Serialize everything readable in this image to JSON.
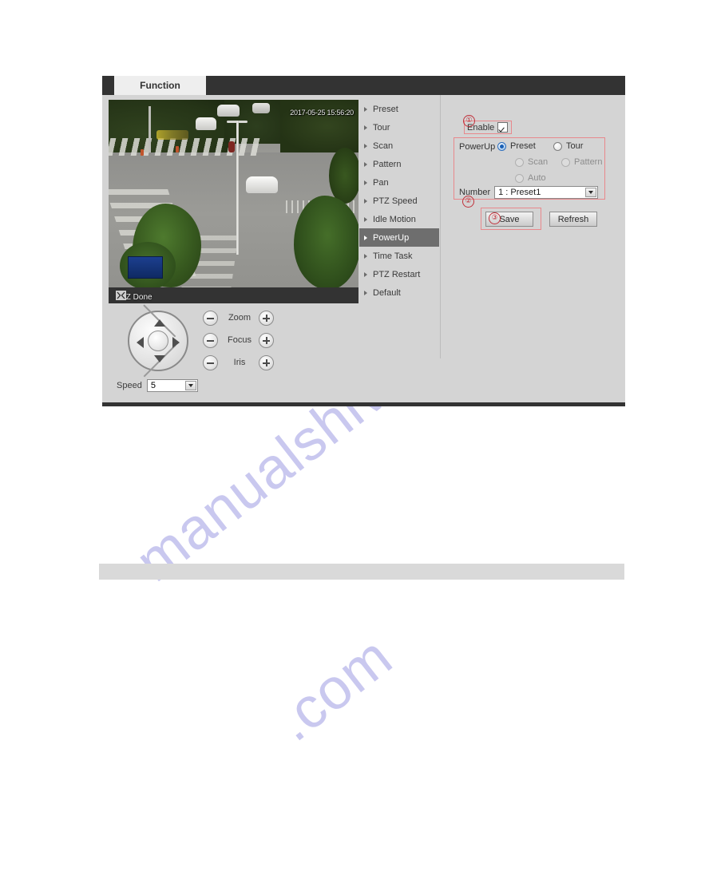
{
  "window": {
    "tab_label": "Function"
  },
  "video": {
    "timestamp": "2017-05-25 15:56:20",
    "status_text": "PTZ Done",
    "toolbar_icon": "fullscreen-icon"
  },
  "ptz_menu": {
    "items": [
      {
        "label": "Preset",
        "active": false
      },
      {
        "label": "Tour",
        "active": false
      },
      {
        "label": "Scan",
        "active": false
      },
      {
        "label": "Pattern",
        "active": false
      },
      {
        "label": "Pan",
        "active": false
      },
      {
        "label": "PTZ Speed",
        "active": false
      },
      {
        "label": "Idle Motion",
        "active": false
      },
      {
        "label": "PowerUp",
        "active": true
      },
      {
        "label": "Time Task",
        "active": false
      },
      {
        "label": "PTZ Restart",
        "active": false
      },
      {
        "label": "Default",
        "active": false
      }
    ]
  },
  "settings": {
    "enable": {
      "label": "Enable",
      "checked": true
    },
    "powerup": {
      "label": "PowerUp",
      "options": [
        {
          "label": "Preset",
          "selected": true,
          "disabled": false
        },
        {
          "label": "Tour",
          "selected": false,
          "disabled": false
        },
        {
          "label": "Scan",
          "selected": false,
          "disabled": true
        },
        {
          "label": "Pattern",
          "selected": false,
          "disabled": true
        },
        {
          "label": "Auto",
          "selected": false,
          "disabled": true
        }
      ]
    },
    "number": {
      "label": "Number",
      "value": "1 : Preset1"
    },
    "buttons": {
      "save": "Save",
      "refresh": "Refresh"
    }
  },
  "annotations": {
    "one": "①",
    "two": "②",
    "three": "③"
  },
  "ptz_controls": {
    "pad": {
      "up": "arrow-up-icon",
      "down": "arrow-down-icon",
      "left": "arrow-left-icon",
      "right": "arrow-right-icon",
      "center": "center-button"
    },
    "adjust_rows": [
      {
        "label": "Zoom"
      },
      {
        "label": "Focus"
      },
      {
        "label": "Iris"
      }
    ],
    "speed": {
      "label": "Speed",
      "value": "5"
    }
  },
  "watermark": {
    "line1": "manualshive",
    "line2": ".com"
  },
  "colors": {
    "annotation_red": "#c0303a",
    "panel_bg": "#d4d4d4",
    "tab_bar": "#333333",
    "active_menu": "#6e6e6e",
    "watermark": "#c9c8ef"
  }
}
